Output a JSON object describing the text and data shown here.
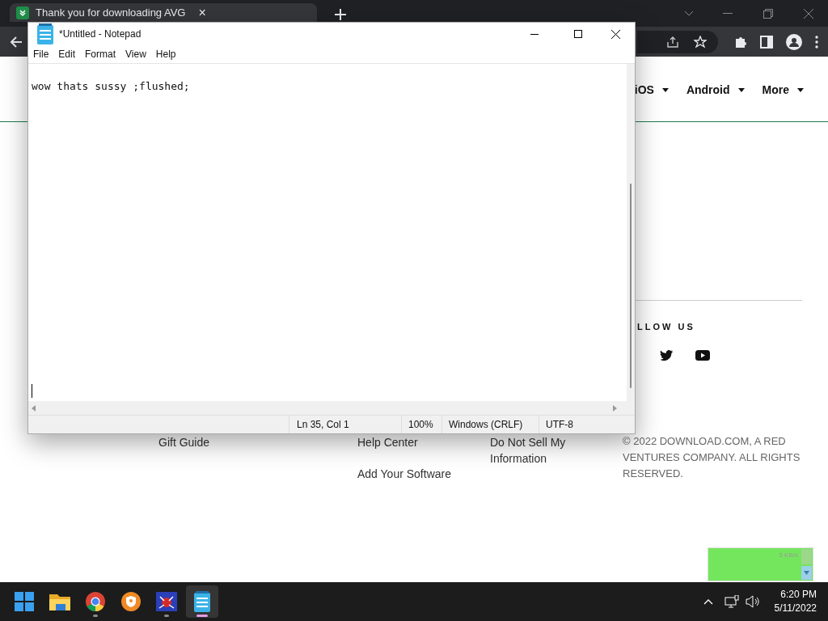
{
  "browser": {
    "tab": {
      "title": "Thank you for downloading AVG",
      "close": "×"
    },
    "nav": [
      {
        "label": "iOS"
      },
      {
        "label": "Android"
      },
      {
        "label": "More"
      }
    ],
    "footer": {
      "col1": [
        "Gift Guide"
      ],
      "col2": [
        "Help Center",
        "Add Your Software"
      ],
      "col3": [
        "Do Not Sell My Information"
      ],
      "follow_title": "LLOW US",
      "copyright": "© 2022 DOWNLOAD.COM, A RED VENTURES COMPANY. ALL RIGHTS RESERVED."
    }
  },
  "notepad": {
    "title": "*Untitled - Notepad",
    "menu": [
      {
        "label": "File"
      },
      {
        "label": "Edit"
      },
      {
        "label": "Format"
      },
      {
        "label": "View"
      },
      {
        "label": "Help"
      }
    ],
    "text": "wow thats sussy ;flushed;",
    "status": {
      "position": "Ln 35, Col 1",
      "zoom": "100%",
      "line_ending": "Windows (CRLF)",
      "encoding": "UTF-8"
    }
  },
  "net_meter": {
    "speed": "5 KB/s"
  },
  "taskbar": {
    "apps": [
      {
        "kind": "start",
        "running": false,
        "selected": false
      },
      {
        "kind": "folder",
        "running": false,
        "selected": false
      },
      {
        "kind": "chrome",
        "running": true,
        "selected": false
      },
      {
        "kind": "brave",
        "running": false,
        "selected": false
      },
      {
        "kind": "spider",
        "running": true,
        "selected": false
      },
      {
        "kind": "notepad",
        "running": true,
        "selected": true
      }
    ],
    "time": "6:20 PM",
    "date": "5/11/2022"
  }
}
